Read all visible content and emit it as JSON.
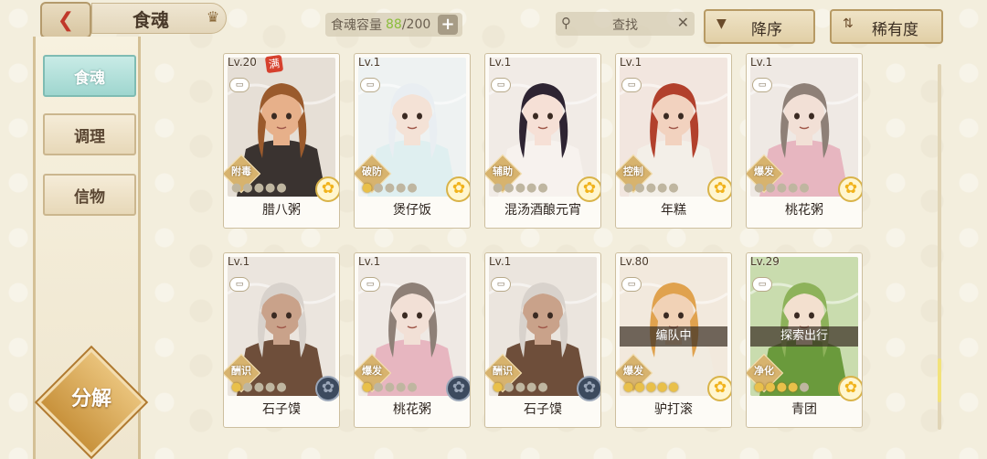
{
  "header": {
    "back_glyph": "❮",
    "title": "食魂",
    "crown_glyph": "♛",
    "capacity_label": "食魂容量",
    "capacity_current": "88",
    "capacity_max": "/200",
    "capacity_add": "+",
    "search_placeholder": "查找",
    "search_icon": "⚲",
    "search_clear": "✕",
    "sort_label": "降序",
    "sort_icon": "▼",
    "rarity_label": "稀有度",
    "rarity_icon": "⇅"
  },
  "sidebar": {
    "tabs": [
      {
        "label": "食魂",
        "active": true
      },
      {
        "label": "调理",
        "active": false
      },
      {
        "label": "信物",
        "active": false
      }
    ],
    "decompose_label": "分解"
  },
  "cards": [
    {
      "level": "Lv.20",
      "badge": "满",
      "role": "附毒",
      "name": "腊八粥",
      "stars_lit": 0,
      "rarity": "gold",
      "status": "",
      "palette": {
        "skin": "#e7b08a",
        "hair": "#9a5a2c",
        "cloth": "#3a3330",
        "bg": "#e6dfd6"
      }
    },
    {
      "level": "Lv.1",
      "badge": "",
      "role": "破防",
      "name": "煲仔饭",
      "stars_lit": 1,
      "rarity": "gold",
      "status": "",
      "palette": {
        "skin": "#f4e2d6",
        "hair": "#e9eef2",
        "cloth": "#dfeff0",
        "bg": "#eef2f2"
      }
    },
    {
      "level": "Lv.1",
      "badge": "",
      "role": "辅助",
      "name": "混汤酒酿元宵",
      "stars_lit": 0,
      "rarity": "gold",
      "status": "",
      "palette": {
        "skin": "#f6e0d6",
        "hair": "#2e2432",
        "cloth": "#f7f2ee",
        "bg": "#f1ebe6"
      }
    },
    {
      "level": "Lv.1",
      "badge": "",
      "role": "控制",
      "name": "年糕",
      "stars_lit": 0,
      "rarity": "gold",
      "status": "",
      "palette": {
        "skin": "#f2d2bf",
        "hair": "#b2402c",
        "cloth": "#f3efe8",
        "bg": "#f2e6df"
      }
    },
    {
      "level": "Lv.1",
      "badge": "",
      "role": "爆发",
      "name": "桃花粥",
      "stars_lit": 0,
      "rarity": "gold",
      "status": "",
      "palette": {
        "skin": "#f2e0d6",
        "hair": "#8e8077",
        "cloth": "#e7b6c0",
        "bg": "#efe9e4"
      }
    },
    {
      "level": "Lv.1",
      "badge": "",
      "role": "酬识",
      "name": "石子馍",
      "stars_lit": 1,
      "rarity": "dark",
      "status": "",
      "palette": {
        "skin": "#c9a28a",
        "hair": "#d8d2cc",
        "cloth": "#6e4e3a",
        "bg": "#ebe5de"
      }
    },
    {
      "level": "Lv.1",
      "badge": "",
      "role": "爆发",
      "name": "桃花粥",
      "stars_lit": 1,
      "rarity": "dark",
      "status": "",
      "palette": {
        "skin": "#f2e0d6",
        "hair": "#8e8077",
        "cloth": "#e7b6c0",
        "bg": "#efe9e4"
      }
    },
    {
      "level": "Lv.1",
      "badge": "",
      "role": "酬识",
      "name": "石子馍",
      "stars_lit": 1,
      "rarity": "dark",
      "status": "",
      "palette": {
        "skin": "#c9a28a",
        "hair": "#d8d2cc",
        "cloth": "#6e4e3a",
        "bg": "#ebe5de"
      }
    },
    {
      "level": "Lv.80",
      "badge": "",
      "role": "爆发",
      "name": "驴打滚",
      "stars_lit": 5,
      "rarity": "gold",
      "status": "编队中",
      "palette": {
        "skin": "#f1d2b6",
        "hair": "#e0a24e",
        "cloth": "#f1ebe0",
        "bg": "#f2e9dd"
      }
    },
    {
      "level": "Lv.29",
      "badge": "",
      "role": "净化",
      "name": "青团",
      "stars_lit": 4,
      "rarity": "gold",
      "status": "探索出行",
      "palette": {
        "skin": "#f3e0cf",
        "hair": "#8db25a",
        "cloth": "#6a9a3c",
        "bg": "#c9dcae"
      }
    }
  ]
}
